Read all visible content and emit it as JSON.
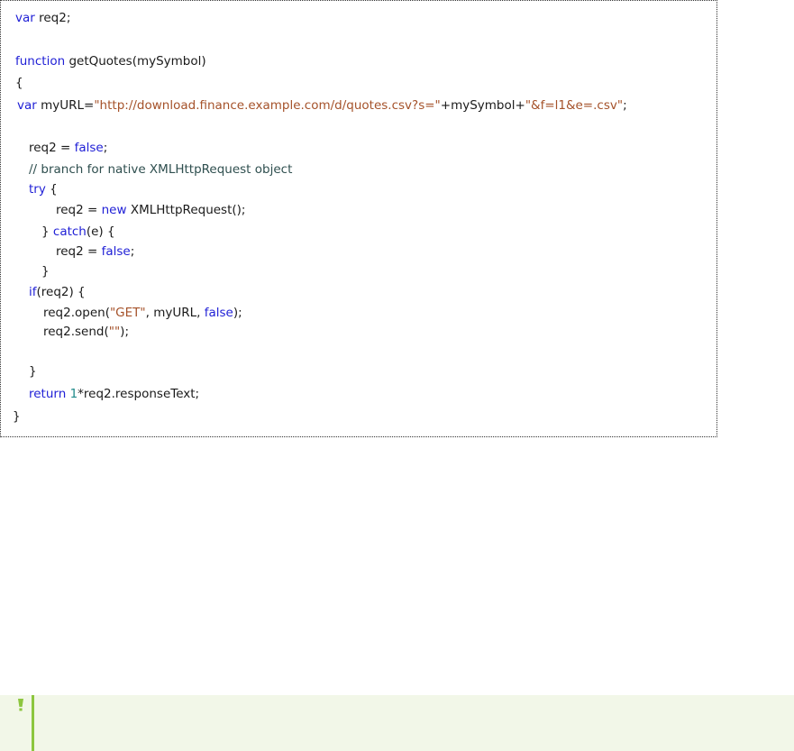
{
  "code_block": {
    "lines": [
      [
        {
          "t": "var",
          "c": "kw"
        },
        {
          "t": " req2;",
          "c": ""
        }
      ],
      [],
      [
        {
          "t": "function",
          "c": "kw"
        },
        {
          "t": " getQuotes(mySymbol)",
          "c": ""
        }
      ],
      [
        {
          "t": "{",
          "c": ""
        }
      ],
      [
        {
          "t": "var",
          "c": "kw"
        },
        {
          "t": " myURL=",
          "c": ""
        },
        {
          "t": "\"http://download.finance.example.com/d/quotes.csv?s=\"",
          "c": "str"
        },
        {
          "t": "+mySymbol+",
          "c": ""
        },
        {
          "t": "\"&f=l1&e=.csv\"",
          "c": "str"
        },
        {
          "t": ";",
          "c": ""
        }
      ],
      [],
      [
        {
          "t": "req2 = ",
          "c": ""
        },
        {
          "t": "false",
          "c": "kw"
        },
        {
          "t": ";",
          "c": ""
        }
      ],
      [
        {
          "t": "// branch for native XMLHttpRequest object",
          "c": "cm"
        }
      ],
      [
        {
          "t": "try",
          "c": "kw"
        },
        {
          "t": " {",
          "c": ""
        }
      ],
      [
        {
          "t": "req2 = ",
          "c": ""
        },
        {
          "t": "new",
          "c": "kw"
        },
        {
          "t": " XMLHttpRequest();",
          "c": ""
        }
      ],
      [
        {
          "t": "} ",
          "c": ""
        },
        {
          "t": "catch",
          "c": "kw"
        },
        {
          "t": "(e) {",
          "c": ""
        }
      ],
      [
        {
          "t": "req2 = ",
          "c": ""
        },
        {
          "t": "false",
          "c": "kw"
        },
        {
          "t": ";",
          "c": ""
        }
      ],
      [
        {
          "t": "}",
          "c": ""
        }
      ],
      [
        {
          "t": "if",
          "c": "kw"
        },
        {
          "t": "(req2) {",
          "c": ""
        }
      ],
      [
        {
          "t": "req2.open(",
          "c": ""
        },
        {
          "t": "\"GET\"",
          "c": "str"
        },
        {
          "t": ", myURL, ",
          "c": ""
        },
        {
          "t": "false",
          "c": "kw"
        },
        {
          "t": ");",
          "c": ""
        }
      ],
      [
        {
          "t": "req2.send(",
          "c": ""
        },
        {
          "t": "\"\"",
          "c": "str"
        },
        {
          "t": ");",
          "c": ""
        }
      ],
      [],
      [
        {
          "t": "}",
          "c": ""
        }
      ],
      [
        {
          "t": "return",
          "c": "kw"
        },
        {
          "t": " ",
          "c": ""
        },
        {
          "t": "1",
          "c": "num"
        },
        {
          "t": "*req2.responseText;",
          "c": ""
        }
      ],
      [
        {
          "t": "}",
          "c": ""
        }
      ]
    ]
  },
  "tip": {
    "icon": "exclamation-icon",
    "text": "",
    "accent_color": "#8dc63f",
    "background_color": "#f2f7e8"
  },
  "colors": {
    "keyword": "#1f1fd6",
    "string": "#a5522a",
    "comment": "#2f4f4f",
    "number": "#1f8a8a"
  }
}
